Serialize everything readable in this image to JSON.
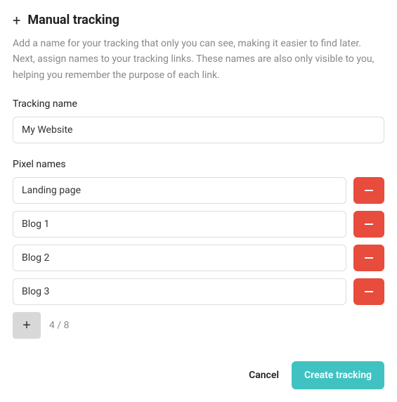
{
  "header": {
    "title": "Manual tracking"
  },
  "description": "Add a name for your tracking that only you can see, making it easier to find later. Next, assign names to your tracking links. These names are also only visible to you, helping you remember the purpose of each link.",
  "tracking_name": {
    "label": "Tracking name",
    "value": "My Website"
  },
  "pixel_names": {
    "label": "Pixel names",
    "items": [
      {
        "value": "Landing page"
      },
      {
        "value": "Blog 1"
      },
      {
        "value": "Blog 2"
      },
      {
        "value": "Blog 3"
      }
    ],
    "counter": "4 / 8"
  },
  "footer": {
    "cancel_label": "Cancel",
    "create_label": "Create tracking"
  }
}
